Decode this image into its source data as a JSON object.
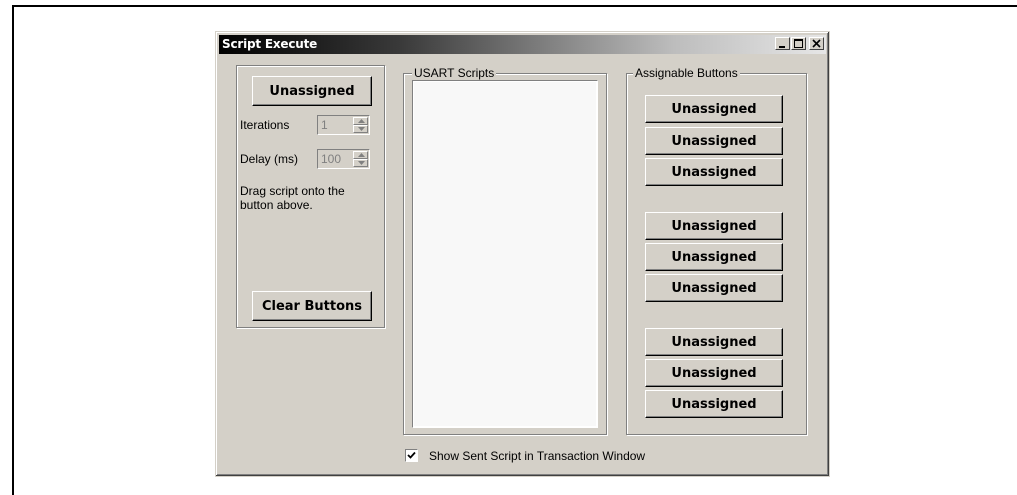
{
  "window": {
    "title": "Script Execute"
  },
  "left_panel": {
    "assign_button": "Unassigned",
    "iterations_label": "Iterations",
    "iterations_value": "1",
    "delay_label": "Delay (ms)",
    "delay_value": "100",
    "help_text": "Drag script onto the button above.",
    "clear_button": "Clear Buttons"
  },
  "scripts_group": {
    "legend": "USART Scripts",
    "items": []
  },
  "assignable_group": {
    "legend": "Assignable Buttons",
    "buttons": [
      "Unassigned",
      "Unassigned",
      "Unassigned",
      "Unassigned",
      "Unassigned",
      "Unassigned",
      "Unassigned",
      "Unassigned",
      "Unassigned"
    ]
  },
  "footer": {
    "checkbox_label": "Show Sent Script in Transaction Window",
    "checked": true
  },
  "colors": {
    "window_face": "#d4d0c8",
    "list_bg": "#f8f8f8"
  }
}
